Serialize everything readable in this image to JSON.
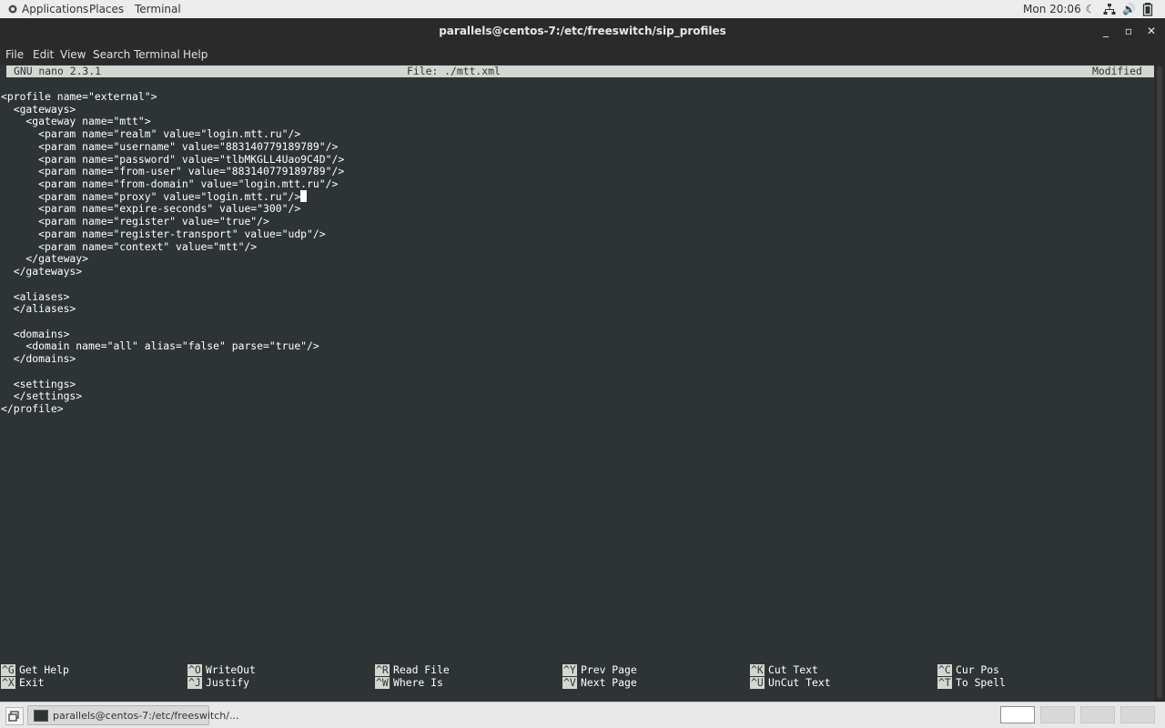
{
  "topbar": {
    "applications": "Applications",
    "places": "Places",
    "terminal": "Terminal",
    "clock": "Mon 20:06",
    "tray_icons": [
      "night-mode-icon",
      "network-icon",
      "volume-icon",
      "battery-icon"
    ]
  },
  "window": {
    "title": "parallels@centos-7:/etc/freeswitch/sip_profiles",
    "buttons": [
      "minimize-icon",
      "maximize-icon",
      "close-icon"
    ]
  },
  "menubar": [
    "File",
    "Edit",
    "View",
    "Search",
    "Terminal",
    "Help"
  ],
  "nano": {
    "version": "GNU nano 2.3.1",
    "file": "File: ./mtt.xml",
    "status": "Modified"
  },
  "code": [
    "<profile name=\"external\">",
    "  <gateways>",
    "    <gateway name=\"mtt\">",
    "      <param name=\"realm\" value=\"login.mtt.ru\"/>",
    "      <param name=\"username\" value=\"883140779189789\"/>",
    "      <param name=\"password\" value=\"tlbMKGLL4Uao9C4D\"/>",
    "      <param name=\"from-user\" value=\"883140779189789\"/>",
    "      <param name=\"from-domain\" value=\"login.mtt.ru\"/>",
    "      <param name=\"proxy\" value=\"login.mtt.ru\"/>",
    "      <param name=\"expire-seconds\" value=\"300\"/>",
    "      <param name=\"register\" value=\"true\"/>",
    "      <param name=\"register-transport\" value=\"udp\"/>",
    "      <param name=\"context\" value=\"mtt\"/>",
    "    </gateway>",
    "  </gateways>",
    "",
    "  <aliases>",
    "  </aliases>",
    "",
    "  <domains>",
    "    <domain name=\"all\" alias=\"false\" parse=\"true\"/>",
    "  </domains>",
    "",
    "  <settings>",
    "  </settings>",
    "</profile>"
  ],
  "shortcuts": {
    "row1": [
      {
        "key": "^G",
        "label": "Get Help"
      },
      {
        "key": "^O",
        "label": "WriteOut"
      },
      {
        "key": "^R",
        "label": "Read File"
      },
      {
        "key": "^Y",
        "label": "Prev Page"
      },
      {
        "key": "^K",
        "label": "Cut Text"
      },
      {
        "key": "^C",
        "label": "Cur Pos"
      }
    ],
    "row2": [
      {
        "key": "^X",
        "label": "Exit"
      },
      {
        "key": "^J",
        "label": "Justify"
      },
      {
        "key": "^W",
        "label": "Where Is"
      },
      {
        "key": "^V",
        "label": "Next Page"
      },
      {
        "key": "^U",
        "label": "UnCut Text"
      },
      {
        "key": "^T",
        "label": "To Spell"
      }
    ]
  },
  "taskbar": {
    "task_label": "parallels@centos-7:/etc/freeswitch/..."
  }
}
